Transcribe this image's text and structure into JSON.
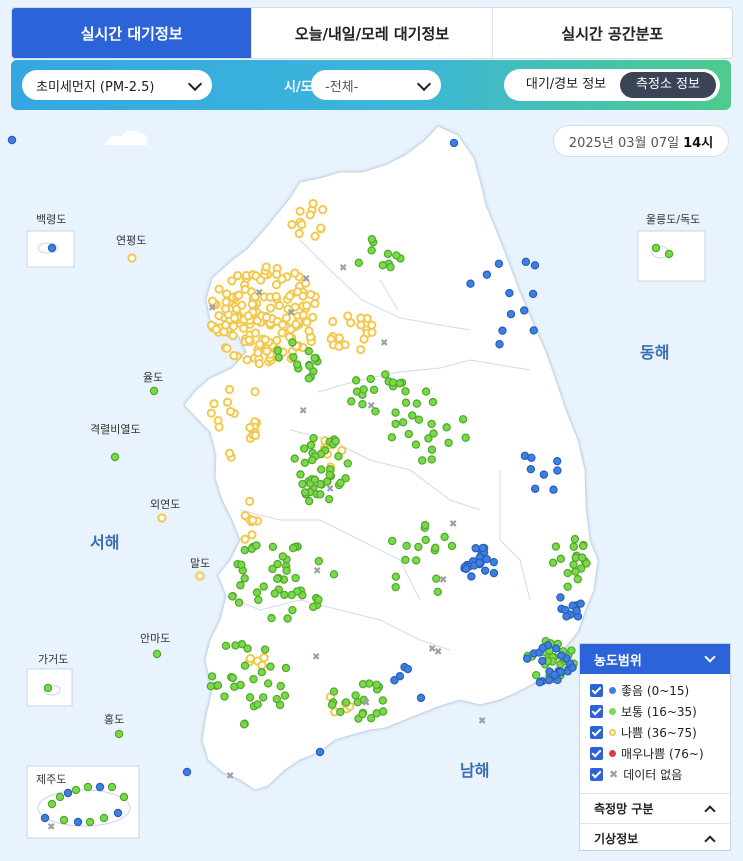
{
  "tabs": [
    "실시간 대기정보",
    "오늘/내일/모레 대기정보",
    "실시간 공간분포"
  ],
  "filter": {
    "pollutant": "초미세먼지 (PM-2.5)",
    "sido_label": "시/도",
    "sido_value": "-전체-",
    "toggle_alert": "대기/경보 정보",
    "toggle_station": "측정소 정보"
  },
  "timestamp": {
    "date": "2025년 03월 07일",
    "hour": "14시"
  },
  "colors": {
    "good": "#3f7fe0",
    "normal": "#7bd84a",
    "bad": "#f2c94c",
    "verybad": "#e03c3c",
    "nodata": "#9aa0a6",
    "land": "#ffffff",
    "sea": "#e8f3fd",
    "accent": "#2c63d8"
  },
  "map": {
    "seas": [
      "동해",
      "서해",
      "남해"
    ],
    "islands": [
      "백령도",
      "연평도",
      "울릉도/독도",
      "율도",
      "격렬비열도",
      "외연도",
      "말도",
      "안마도",
      "가거도",
      "홍도",
      "제주도"
    ]
  },
  "legend": {
    "title": "농도범위",
    "items": [
      {
        "label": "좋음 (0~15)",
        "color": "#3f7fe0",
        "kind": "dot"
      },
      {
        "label": "보통 (16~35)",
        "color": "#7bd84a",
        "kind": "dot"
      },
      {
        "label": "나쁨 (36~75)",
        "color": "#f2c94c",
        "kind": "ring"
      },
      {
        "label": "매우나쁨 (76~)",
        "color": "#e03c3c",
        "kind": "dot"
      },
      {
        "label": "데이터 없음",
        "color": "#9aa0a6",
        "kind": "x"
      }
    ],
    "sections": [
      "측정망 구분",
      "기상정보"
    ]
  }
}
